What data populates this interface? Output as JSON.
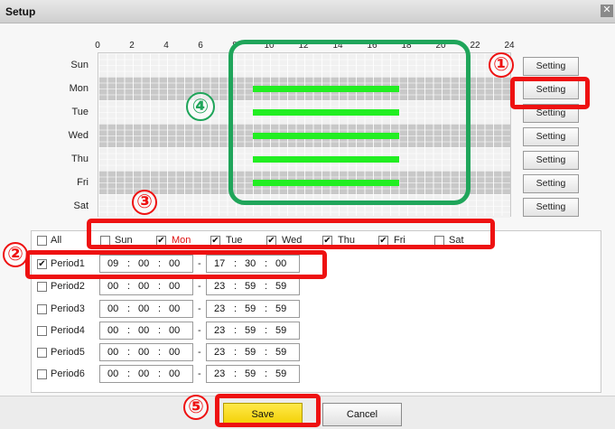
{
  "dialog": {
    "title": "Setup",
    "close_glyph": "✕"
  },
  "timeline": {
    "hours": [
      "0",
      "2",
      "4",
      "6",
      "8",
      "10",
      "12",
      "14",
      "16",
      "18",
      "20",
      "22",
      "24"
    ],
    "days": [
      "Sun",
      "Mon",
      "Tue",
      "Wed",
      "Thu",
      "Fri",
      "Sat"
    ],
    "setting_label": "Setting",
    "scheduled_days": [
      "Mon",
      "Tue",
      "Wed",
      "Thu",
      "Fri"
    ],
    "scheduled_start_hour": 9,
    "scheduled_end_hour": 17.5,
    "bar_color": "#22ee22"
  },
  "weekdays_row": {
    "all_label": "All",
    "days": [
      {
        "label": "Sun",
        "checked": false
      },
      {
        "label": "Mon",
        "checked": true
      },
      {
        "label": "Tue",
        "checked": true
      },
      {
        "label": "Wed",
        "checked": true
      },
      {
        "label": "Thu",
        "checked": true
      },
      {
        "label": "Fri",
        "checked": true
      },
      {
        "label": "Sat",
        "checked": false
      }
    ]
  },
  "periods": [
    {
      "label": "Period1",
      "checked": true,
      "start": [
        "09",
        "00",
        "00"
      ],
      "end": [
        "17",
        "30",
        "00"
      ]
    },
    {
      "label": "Period2",
      "checked": false,
      "start": [
        "00",
        "00",
        "00"
      ],
      "end": [
        "23",
        "59",
        "59"
      ]
    },
    {
      "label": "Period3",
      "checked": false,
      "start": [
        "00",
        "00",
        "00"
      ],
      "end": [
        "23",
        "59",
        "59"
      ]
    },
    {
      "label": "Period4",
      "checked": false,
      "start": [
        "00",
        "00",
        "00"
      ],
      "end": [
        "23",
        "59",
        "59"
      ]
    },
    {
      "label": "Period5",
      "checked": false,
      "start": [
        "00",
        "00",
        "00"
      ],
      "end": [
        "23",
        "59",
        "59"
      ]
    },
    {
      "label": "Period6",
      "checked": false,
      "start": [
        "00",
        "00",
        "00"
      ],
      "end": [
        "23",
        "59",
        "59"
      ]
    }
  ],
  "time_separator": ":",
  "range_separator": "-",
  "check_glyph": "✔",
  "footer": {
    "save_label": "Save",
    "cancel_label": "Cancel"
  },
  "annotations": [
    "①",
    "②",
    "③",
    "④",
    "⑤"
  ],
  "colors": {
    "annotation_red": "#ee1111",
    "annotation_green": "#1fa55a",
    "save_yellow": "#f2cf00"
  }
}
